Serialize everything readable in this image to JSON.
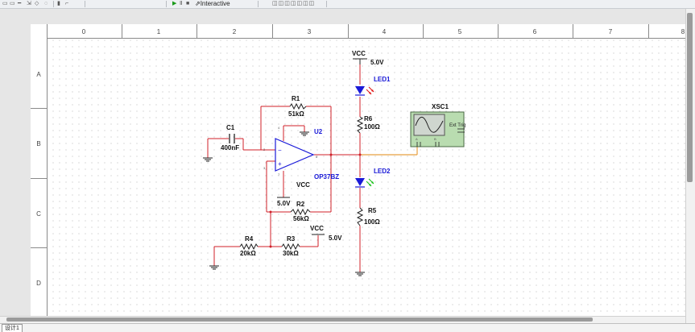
{
  "toolbar": {
    "mode_label": "Interactive",
    "icons": [
      "run-icon",
      "pause-icon",
      "stop-icon"
    ]
  },
  "sheet": {
    "columns": [
      "0",
      "1",
      "2",
      "3",
      "4",
      "5",
      "6",
      "7",
      "8"
    ],
    "rows": [
      "A",
      "B",
      "C",
      "D"
    ]
  },
  "components": {
    "vcc_top": {
      "name": "VCC",
      "value": "5.0V"
    },
    "led1": {
      "name": "LED1"
    },
    "r6": {
      "name": "R6",
      "value": "100Ω"
    },
    "led2": {
      "name": "LED2"
    },
    "r5": {
      "name": "R5",
      "value": "100Ω"
    },
    "r1": {
      "name": "R1",
      "value": "51kΩ"
    },
    "c1": {
      "name": "C1",
      "value": "400nF"
    },
    "u2": {
      "name": "U2",
      "part": "OP37BZ",
      "supply": "VCC",
      "supply_value": "5.0V"
    },
    "r2": {
      "name": "R2",
      "value": "56kΩ"
    },
    "r3": {
      "name": "R3",
      "value": "30kΩ"
    },
    "r4": {
      "name": "R4",
      "value": "20kΩ"
    },
    "vcc_mid": {
      "name": "VCC",
      "value": "5.0V"
    },
    "xsc1": {
      "name": "XSC1",
      "trigger_label": "Ext Trig"
    }
  },
  "status": {
    "tab_label": "设计1"
  },
  "colors": {
    "wire_red": "#d0202a",
    "wire_orange": "#e8a040",
    "component_blue": "#1a1ad8",
    "led_red": "#e01010",
    "led_green": "#10c010",
    "scope_green": "#b9dcb0"
  }
}
